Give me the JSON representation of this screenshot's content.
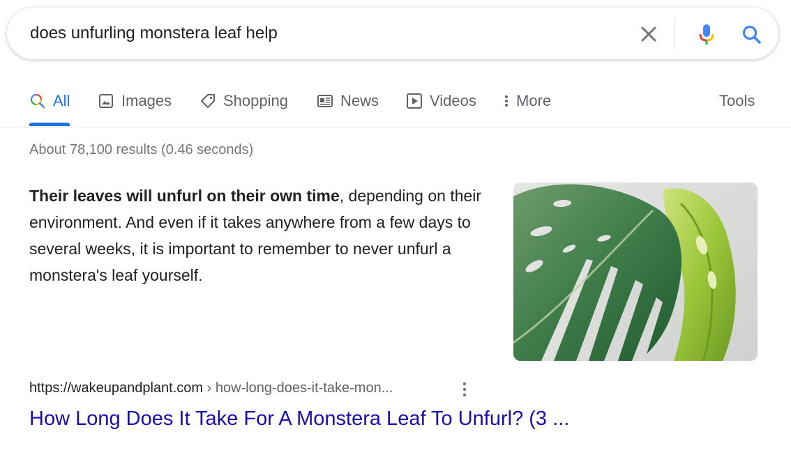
{
  "search": {
    "query": "does unfurling monstera leaf help"
  },
  "tabs": [
    {
      "label": "All",
      "icon": "search-multicolor-icon",
      "active": true
    },
    {
      "label": "Images",
      "icon": "image-icon"
    },
    {
      "label": "Shopping",
      "icon": "tag-icon"
    },
    {
      "label": "News",
      "icon": "newspaper-icon"
    },
    {
      "label": "Videos",
      "icon": "play-icon"
    },
    {
      "label": "More",
      "icon": "vertical-dots-icon"
    },
    {
      "label": "Tools"
    }
  ],
  "result_stats": "About 78,100 results (0.46 seconds)",
  "featured_snippet": {
    "bold_text": "Their leaves will unfurl on their own time",
    "rest_text": ", depending on their environment. And even if it takes anywhere from a few days to several weeks, it is important to remember to never unfurl a monstera's leaf yourself."
  },
  "result": {
    "domain": "https://wakeupandplant.com",
    "path": " › how-long-does-it-take-mon...",
    "title": "How Long Does It Take For A Monstera Leaf To Unfurl? (3 ..."
  },
  "colors": {
    "link": "#1a0dab",
    "accent": "#1a73e8",
    "muted": "#70757a",
    "leaf_dark": "#2f6b3f",
    "leaf_light": "#9ccc3c"
  }
}
